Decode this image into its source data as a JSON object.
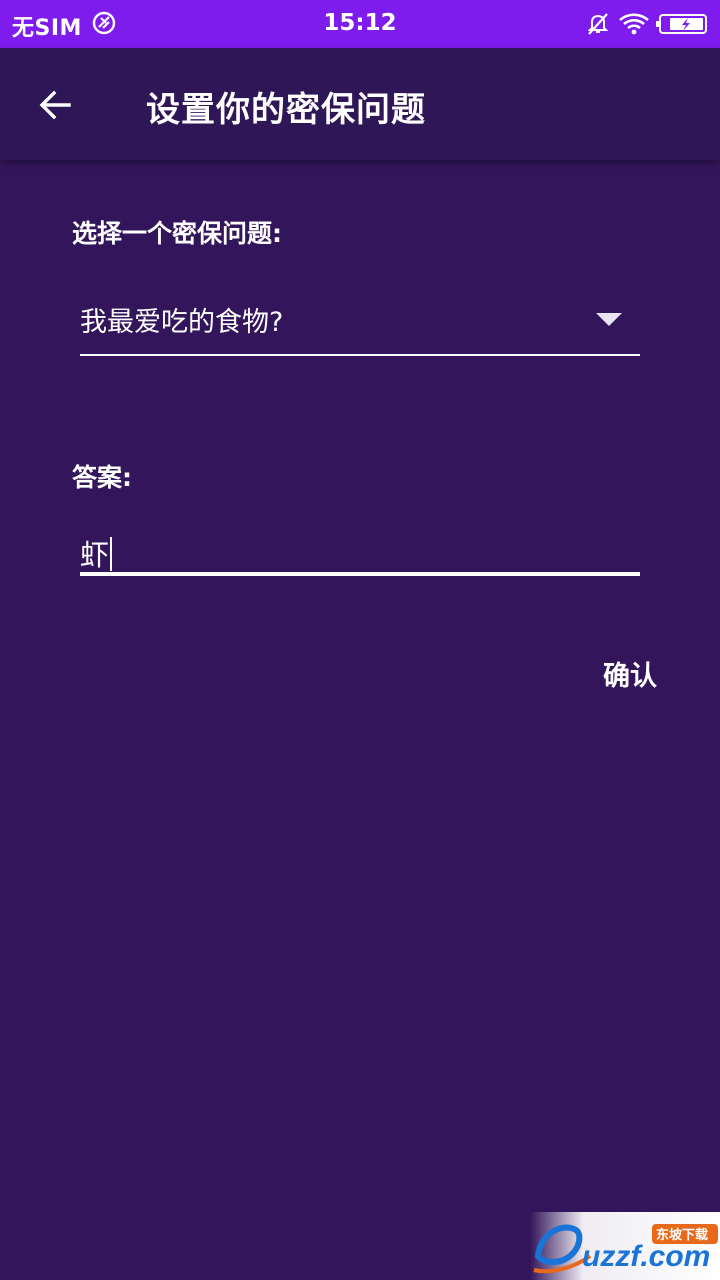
{
  "status_bar": {
    "carrier": "无SIM",
    "time": "15:12",
    "icons": [
      "notification-icon",
      "mute-icon",
      "wifi-icon",
      "battery-charging-icon"
    ],
    "background": "#7d1cec"
  },
  "app_bar": {
    "title": "设置你的密保问题",
    "back_icon": "arrow-left-icon",
    "background": "#2f1656"
  },
  "form": {
    "question_label": "选择一个密保问题:",
    "selected_question": "我最爱吃的食物?",
    "dropdown_icon": "triangle-down-icon",
    "answer_label": "答案:",
    "answer_value": "虾",
    "confirm_label": "确认"
  },
  "watermark": {
    "brand": "uzzf.com",
    "badge": "东坡下载"
  },
  "colors": {
    "background": "#33155b",
    "text": "#ffffff",
    "watermark_blue": "#1a73d6",
    "watermark_orange": "#e8681c"
  }
}
